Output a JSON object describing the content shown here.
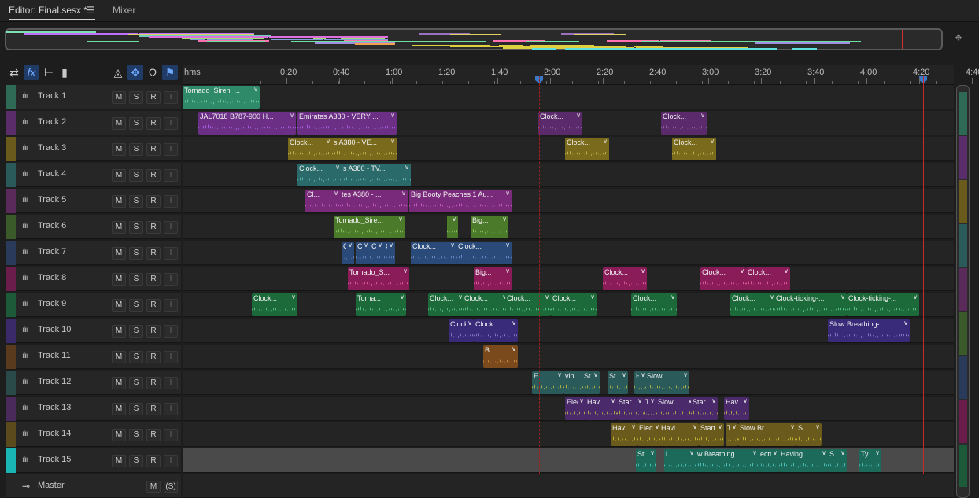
{
  "tabs": {
    "editor": "Editor: Final.sesx *",
    "menu": "☰",
    "mixer": "Mixer"
  },
  "toolbar": {
    "icons": [
      "swap-icon",
      "fx-icon",
      "insert-icon",
      "bars-icon",
      "metronome-icon",
      "move-tool-icon",
      "headphones-icon",
      "marker-icon"
    ]
  },
  "ruler": {
    "labels": [
      "hms",
      "0:20",
      "0:40",
      "1:00",
      "1:20",
      "1:40",
      "2:00",
      "2:20",
      "2:40",
      "3:00",
      "3:20",
      "3:40",
      "4:00",
      "4:20",
      "4:40"
    ]
  },
  "track_buttons": {
    "m": "M",
    "s": "S",
    "r": "R",
    "i": "I"
  },
  "master": {
    "name": "Master",
    "m": "M",
    "s": "(S)"
  },
  "tracks": [
    {
      "name": "Track 1",
      "color": "#2e6a55"
    },
    {
      "name": "Track 2",
      "color": "#5a2c6a"
    },
    {
      "name": "Track 3",
      "color": "#6a5a1c"
    },
    {
      "name": "Track 4",
      "color": "#2a5a5a"
    },
    {
      "name": "Track 5",
      "color": "#5a2a5a"
    },
    {
      "name": "Track 6",
      "color": "#3a5a2a"
    },
    {
      "name": "Track 7",
      "color": "#2a3a5a"
    },
    {
      "name": "Track 8",
      "color": "#6a1c4a"
    },
    {
      "name": "Track 9",
      "color": "#1c5a3a"
    },
    {
      "name": "Track 10",
      "color": "#3a2a6a"
    },
    {
      "name": "Track 11",
      "color": "#5a3a1c"
    },
    {
      "name": "Track 12",
      "color": "#2a4a4a"
    },
    {
      "name": "Track 13",
      "color": "#4a2a5a"
    },
    {
      "name": "Track 14",
      "color": "#5a4a1c"
    },
    {
      "name": "Track 15",
      "color": "#19b5b5"
    }
  ],
  "clips": [
    {
      "track": 0,
      "label": "Tornado_Siren_...",
      "color": "#2f8a6a",
      "wave": "#7fe0b0"
    },
    {
      "track": 1,
      "label": "JAL7018 B787-900 H...",
      "color": "#6b2f86",
      "wave": "#c070ff"
    },
    {
      "track": 1,
      "label": "Emirates A380 - VERY ...",
      "color": "#6b2f86",
      "wave": "#c070ff"
    },
    {
      "track": 1,
      "label": "Clock...",
      "color": "#5a2a6a",
      "wave": "#9a70c0"
    },
    {
      "track": 1,
      "label": "Clock...",
      "color": "#5a2a6a",
      "wave": "#9a70c0"
    },
    {
      "track": 2,
      "label": "Clock...",
      "color": "#7a6a1c",
      "wave": "#e0d060"
    },
    {
      "track": 2,
      "label": "s A380 - VE...",
      "color": "#7a6a1c",
      "wave": "#e0d060"
    },
    {
      "track": 2,
      "label": "Clock...",
      "color": "#7a6a1c",
      "wave": "#e0d060"
    },
    {
      "track": 2,
      "label": "Clock...",
      "color": "#7a6a1c",
      "wave": "#e0d060"
    },
    {
      "track": 3,
      "label": "Clock...",
      "color": "#2a6a6a",
      "wave": "#70d0c0"
    },
    {
      "track": 3,
      "label": "s A380 - TV...",
      "color": "#2a6a6a",
      "wave": "#70d0c0"
    },
    {
      "track": 4,
      "label": "Cl...",
      "color": "#7a2a7a",
      "wave": "#e070e0"
    },
    {
      "track": 4,
      "label": "tes A380 - ...",
      "color": "#7a2a7a",
      "wave": "#e070e0"
    },
    {
      "track": 4,
      "label": "Big Booty Peaches 1 Au...",
      "color": "#7a2a7a",
      "wave": "#e070e0"
    },
    {
      "track": 5,
      "label": "Tornado_Sire...",
      "color": "#4a7a2a",
      "wave": "#a0e070"
    },
    {
      "track": 5,
      "label": "",
      "color": "#4a7a2a",
      "wave": "#a0e070"
    },
    {
      "track": 5,
      "label": "Big...",
      "color": "#4a7a2a",
      "wave": "#a0e070"
    },
    {
      "track": 6,
      "label": "C...",
      "color": "#2a4a7a",
      "wave": "#80a0e0"
    },
    {
      "track": 6,
      "label": "C...",
      "color": "#2a4a7a",
      "wave": "#80a0e0"
    },
    {
      "track": 6,
      "label": "C...",
      "color": "#2a4a7a",
      "wave": "#80a0e0"
    },
    {
      "track": 6,
      "label": "C...",
      "color": "#2a4a7a",
      "wave": "#80a0e0"
    },
    {
      "track": 6,
      "label": "Clock...",
      "color": "#2a4a7a",
      "wave": "#80a0e0"
    },
    {
      "track": 6,
      "label": "Clock...",
      "color": "#2a4a7a",
      "wave": "#80a0e0"
    },
    {
      "track": 7,
      "label": "Tornado_S...",
      "color": "#8a1c5a",
      "wave": "#ff70b0"
    },
    {
      "track": 7,
      "label": "Big...",
      "color": "#8a1c5a",
      "wave": "#ff70b0"
    },
    {
      "track": 7,
      "label": "Clock...",
      "color": "#8a1c5a",
      "wave": "#ff70b0"
    },
    {
      "track": 7,
      "label": "Clock...",
      "color": "#8a1c5a",
      "wave": "#ff70b0"
    },
    {
      "track": 7,
      "label": "Clock...",
      "color": "#8a1c5a",
      "wave": "#ff70b0"
    },
    {
      "track": 8,
      "label": "Clock...",
      "color": "#1c6a3a",
      "wave": "#70e0a0"
    },
    {
      "track": 8,
      "label": "Torna...",
      "color": "#1c6a3a",
      "wave": "#70e0a0"
    },
    {
      "track": 8,
      "label": "Clock...",
      "color": "#1c6a3a",
      "wave": "#70e0a0"
    },
    {
      "track": 8,
      "label": "Clock...",
      "color": "#1c6a3a",
      "wave": "#70e0a0"
    },
    {
      "track": 8,
      "label": "Clock...",
      "color": "#1c6a3a",
      "wave": "#70e0a0"
    },
    {
      "track": 8,
      "label": "Clock...",
      "color": "#1c6a3a",
      "wave": "#70e0a0"
    },
    {
      "track": 8,
      "label": "Clock...",
      "color": "#1c6a3a",
      "wave": "#70e0a0"
    },
    {
      "track": 8,
      "label": "Clock...",
      "color": "#1c6a3a",
      "wave": "#70e0a0"
    },
    {
      "track": 8,
      "label": "Clock-ticking-...",
      "color": "#1c6a3a",
      "wave": "#70e0a0"
    },
    {
      "track": 8,
      "label": "Clock-ticking-...",
      "color": "#1c6a3a",
      "wave": "#70e0a0"
    },
    {
      "track": 9,
      "label": "Clock...",
      "color": "#3a2a7a",
      "wave": "#a090e0"
    },
    {
      "track": 9,
      "label": "Clock...",
      "color": "#3a2a7a",
      "wave": "#a090e0"
    },
    {
      "track": 9,
      "label": "Slow Breathing-...",
      "color": "#3a2a7a",
      "wave": "#a090e0"
    },
    {
      "track": 10,
      "label": "B...",
      "color": "#7a4a1c",
      "wave": "#f0a050"
    },
    {
      "track": 11,
      "label": "E...",
      "color": "#2a5a5a",
      "wave": "#e0d040"
    },
    {
      "track": 11,
      "label": "vin...",
      "color": "#2a5a5a",
      "wave": "#e0d040"
    },
    {
      "track": 11,
      "label": "St...",
      "color": "#2a5a5a",
      "wave": "#e0d040"
    },
    {
      "track": 11,
      "label": "St...",
      "color": "#2a5a5a",
      "wave": "#e0d040"
    },
    {
      "track": 11,
      "label": "H...",
      "color": "#2a5a5a",
      "wave": "#e0d040"
    },
    {
      "track": 11,
      "label": "Slow...",
      "color": "#2a5a5a",
      "wave": "#e0d040"
    },
    {
      "track": 12,
      "label": "Elec...",
      "color": "#4a2a6a",
      "wave": "#e0d040"
    },
    {
      "track": 12,
      "label": "Hav...",
      "color": "#4a2a6a",
      "wave": "#e0d040"
    },
    {
      "track": 12,
      "label": "Star...",
      "color": "#4a2a6a",
      "wave": "#e0d040"
    },
    {
      "track": 12,
      "label": "T...",
      "color": "#4a2a6a",
      "wave": "#e0d040"
    },
    {
      "track": 12,
      "label": "Slow ...",
      "color": "#4a2a6a",
      "wave": "#e0d040"
    },
    {
      "track": 12,
      "label": "Star...",
      "color": "#4a2a6a",
      "wave": "#e0d040"
    },
    {
      "track": 12,
      "label": "Hav...",
      "color": "#4a2a6a",
      "wave": "#e0d040"
    },
    {
      "track": 13,
      "label": "Hav...",
      "color": "#6a5a1c",
      "wave": "#e0d040"
    },
    {
      "track": 13,
      "label": "Electri...",
      "color": "#6a5a1c",
      "wave": "#e0d040"
    },
    {
      "track": 13,
      "label": "Havi...",
      "color": "#6a5a1c",
      "wave": "#e0d040"
    },
    {
      "track": 13,
      "label": "Start...",
      "color": "#6a5a1c",
      "wave": "#e0d040"
    },
    {
      "track": 13,
      "label": "T...",
      "color": "#6a5a1c",
      "wave": "#e0d040"
    },
    {
      "track": 13,
      "label": "Slow Br...",
      "color": "#6a5a1c",
      "wave": "#e0d040"
    },
    {
      "track": 13,
      "label": "S...",
      "color": "#6a5a1c",
      "wave": "#e0d040"
    },
    {
      "track": 14,
      "label": "St...",
      "color": "#1c6a5a",
      "wave": "#60e0e0"
    },
    {
      "track": 14,
      "label": "i...",
      "color": "#1c6a5a",
      "wave": "#60e0e0"
    },
    {
      "track": 14,
      "label": "w Breathing...",
      "color": "#1c6a5a",
      "wave": "#60e0e0"
    },
    {
      "track": 14,
      "label": "ectric...",
      "color": "#1c6a5a",
      "wave": "#60e0e0"
    },
    {
      "track": 14,
      "label": "Having ...",
      "color": "#1c6a5a",
      "wave": "#60e0e0"
    },
    {
      "track": 14,
      "label": "S...",
      "color": "#1c6a5a",
      "wave": "#60e0e0"
    },
    {
      "track": 14,
      "label": "Ty...",
      "color": "#1c6a5a",
      "wave": "#60e0e0"
    }
  ]
}
